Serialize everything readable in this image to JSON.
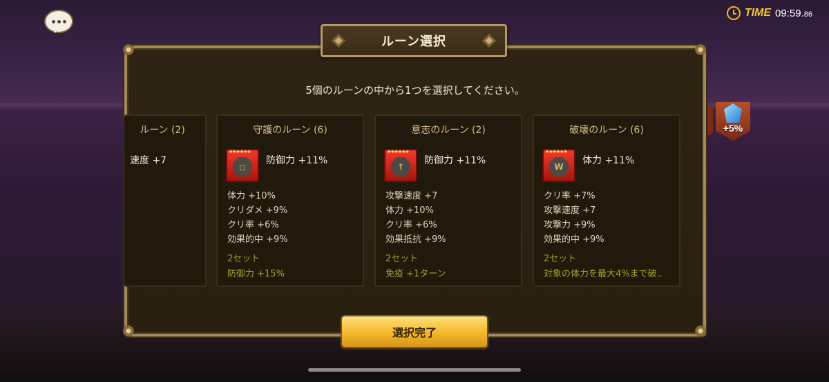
{
  "hud": {
    "time_label": "TIME",
    "time_value": "09:59.",
    "time_fraction": "86"
  },
  "crest": {
    "bonus": "+5%"
  },
  "dialog": {
    "title": "ルーン選択",
    "instruction": "5個のルーンの中から1つを選択してください。",
    "confirm_label": "選択完了"
  },
  "cards": [
    {
      "title": "ルーン (2)",
      "main_stat": "速度 +7"
    },
    {
      "title": "守護のルーン (6)",
      "icon": "guard-rune-icon",
      "glyph": "◻",
      "main_stat": "防御力 +11%",
      "sub_stats": [
        "体力 +10%",
        "クリダメ +9%",
        "クリ率 +6%",
        "効果的中 +9%"
      ],
      "set_label": "2セット",
      "set_effect": "防御力 +15%"
    },
    {
      "title": "意志のルーン (2)",
      "icon": "will-rune-icon",
      "glyph": "↑",
      "main_stat": "防御力 +11%",
      "sub_stats": [
        "攻撃速度 +7",
        "体力 +10%",
        "クリ率 +6%",
        "効果抵抗 +9%"
      ],
      "set_label": "2セット",
      "set_effect": "免疫 +1ターン"
    },
    {
      "title": "破壊のルーン (6)",
      "icon": "destroy-rune-icon",
      "glyph": "W",
      "main_stat": "体力 +11%",
      "sub_stats": [
        "クリ率 +7%",
        "攻撃速度 +7",
        "攻撃力 +9%",
        "効果的中 +9%"
      ],
      "set_label": "2セット",
      "set_effect": "対象の体力を最大4%まで破.."
    }
  ],
  "rune_stars": "★★★★★★",
  "colors": {
    "title_gold": "#d9c08a",
    "set_text": "#a6a232",
    "button_gold": "#f2b72a"
  }
}
